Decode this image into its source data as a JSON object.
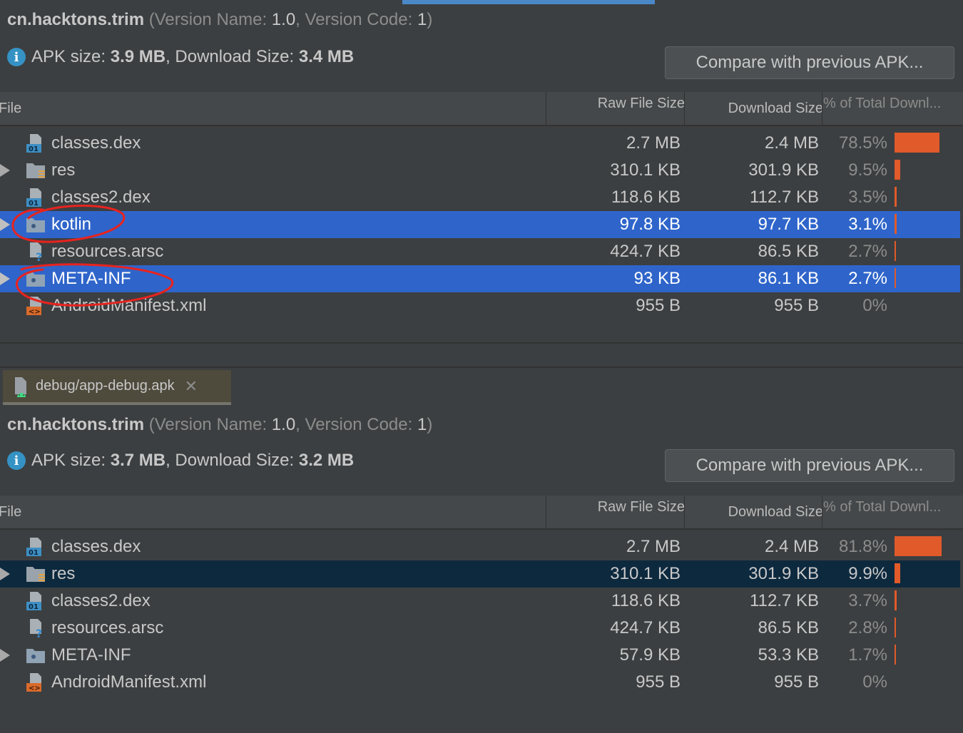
{
  "panels": [
    {
      "package": "cn.hacktons.trim",
      "version_name_label": "Version Name:",
      "version_name": "1.0",
      "version_code_label": "Version Code:",
      "version_code": "1",
      "apk_size_label": "APK size:",
      "apk_size": "3.9 MB",
      "download_size_label": "Download Size:",
      "download_size": "3.4 MB",
      "compare_button": "Compare with previous APK...",
      "columns": {
        "file": "File",
        "raw": "Raw File Size",
        "download": "Download Size",
        "percent": "% of Total Downl..."
      },
      "rows": [
        {
          "name": "classes.dex",
          "icon": "dex-file-icon",
          "raw": "2.7 MB",
          "download": "2.4 MB",
          "percent": "78.5%",
          "fraction": 0.785,
          "expandable": false,
          "state": "normal"
        },
        {
          "name": "res",
          "icon": "res-folder-icon",
          "raw": "310.1 KB",
          "download": "301.9 KB",
          "percent": "9.5%",
          "fraction": 0.095,
          "expandable": true,
          "state": "normal"
        },
        {
          "name": "classes2.dex",
          "icon": "dex-file-icon",
          "raw": "118.6 KB",
          "download": "112.7 KB",
          "percent": "3.5%",
          "fraction": 0.035,
          "expandable": false,
          "state": "normal"
        },
        {
          "name": "kotlin",
          "icon": "folder-icon",
          "raw": "97.8 KB",
          "download": "97.7 KB",
          "percent": "3.1%",
          "fraction": 0.031,
          "expandable": true,
          "state": "selected"
        },
        {
          "name": "resources.arsc",
          "icon": "unknown-file-icon",
          "raw": "424.7 KB",
          "download": "86.5 KB",
          "percent": "2.7%",
          "fraction": 0.027,
          "expandable": false,
          "state": "normal"
        },
        {
          "name": "META-INF",
          "icon": "folder-icon",
          "raw": "93 KB",
          "download": "86.1 KB",
          "percent": "2.7%",
          "fraction": 0.027,
          "expandable": true,
          "state": "selected"
        },
        {
          "name": "AndroidManifest.xml",
          "icon": "xml-file-icon",
          "raw": "955 B",
          "download": "955 B",
          "percent": "0%",
          "fraction": 0,
          "expandable": false,
          "state": "normal"
        }
      ]
    },
    {
      "package": "cn.hacktons.trim",
      "version_name_label": "Version Name:",
      "version_name": "1.0",
      "version_code_label": "Version Code:",
      "version_code": "1",
      "apk_size_label": "APK size:",
      "apk_size": "3.7 MB",
      "download_size_label": "Download Size:",
      "download_size": "3.2 MB",
      "compare_button": "Compare with previous APK...",
      "columns": {
        "file": "File",
        "raw": "Raw File Size",
        "download": "Download Size",
        "percent": "% of Total Downl..."
      },
      "rows": [
        {
          "name": "classes.dex",
          "icon": "dex-file-icon",
          "raw": "2.7 MB",
          "download": "2.4 MB",
          "percent": "81.8%",
          "fraction": 0.818,
          "expandable": false,
          "state": "normal"
        },
        {
          "name": "res",
          "icon": "res-folder-icon",
          "raw": "310.1 KB",
          "download": "301.9 KB",
          "percent": "9.9%",
          "fraction": 0.099,
          "expandable": true,
          "state": "focused"
        },
        {
          "name": "classes2.dex",
          "icon": "dex-file-icon",
          "raw": "118.6 KB",
          "download": "112.7 KB",
          "percent": "3.7%",
          "fraction": 0.037,
          "expandable": false,
          "state": "normal"
        },
        {
          "name": "resources.arsc",
          "icon": "unknown-file-icon",
          "raw": "424.7 KB",
          "download": "86.5 KB",
          "percent": "2.8%",
          "fraction": 0.028,
          "expandable": false,
          "state": "normal"
        },
        {
          "name": "META-INF",
          "icon": "folder-icon",
          "raw": "57.9 KB",
          "download": "53.3 KB",
          "percent": "1.7%",
          "fraction": 0.017,
          "expandable": true,
          "state": "normal"
        },
        {
          "name": "AndroidManifest.xml",
          "icon": "xml-file-icon",
          "raw": "955 B",
          "download": "955 B",
          "percent": "0%",
          "fraction": 0,
          "expandable": false,
          "state": "normal"
        }
      ]
    }
  ],
  "tab": {
    "label": "debug/app-debug.apk",
    "close": "✕"
  },
  "colors": {
    "bar": "#e05a2a",
    "selection": "#2f65ca",
    "annotation": "#e8231f",
    "accent": "#4a88c7"
  }
}
